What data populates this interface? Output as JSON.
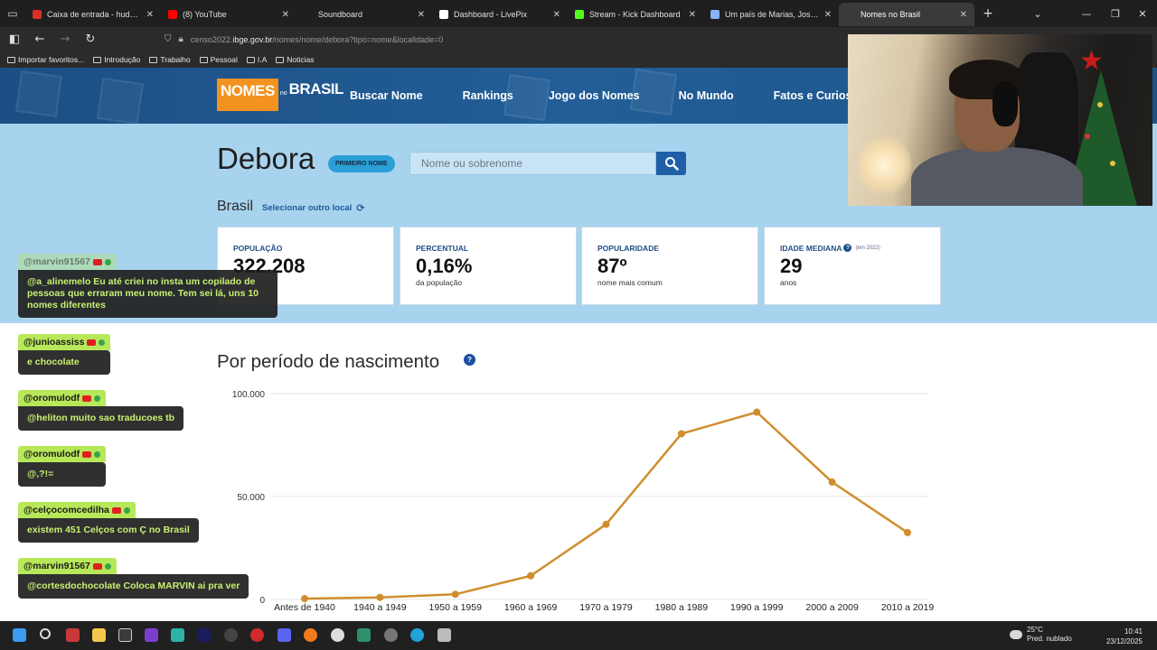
{
  "browser": {
    "tabs": [
      {
        "title": "Caixa de entrada - hudsonfabio",
        "color": "#d93025",
        "active": false
      },
      {
        "title": "(8) YouTube",
        "color": "#ff0000",
        "active": false
      },
      {
        "title": "Soundboard",
        "color": "#1f1f1f",
        "active": false
      },
      {
        "title": "Dashboard - LivePix",
        "color": "#ffffff",
        "active": false
      },
      {
        "title": "Stream - Kick Dashboard",
        "color": "#53fc18",
        "active": false
      },
      {
        "title": "Um país de Marias, Josés, Silvas",
        "color": "#8ab4f8",
        "active": false
      },
      {
        "title": "Nomes no Brasil",
        "color": "#3a3a3a",
        "active": true
      }
    ],
    "new_tab": "+",
    "url_prefix": "censo2022.",
    "url_host": "ibge.gov.br",
    "url_path": "/nomes/nome/debora?tipo=nome&localidade=0",
    "bookmarks": [
      "Importar favoritos...",
      "Introdução",
      "Trabalho",
      "Pessoal",
      "I.A",
      "Noticias"
    ]
  },
  "site": {
    "logo_nomes": "NOMES",
    "logo_no": "no",
    "logo_brasil": "BRASIL",
    "nav": [
      "Buscar Nome",
      "Rankings",
      "Jogo dos Nomes",
      "No Mundo",
      "Fatos e Curiosidades"
    ]
  },
  "hero": {
    "name": "Debora",
    "badge": "PRIMEIRO NOME",
    "search_placeholder": "Nome ou sobrenome",
    "place": "Brasil",
    "select_local": "Selecionar outro local"
  },
  "cards": [
    {
      "label": "POPULAÇÃO",
      "value": "322.208",
      "sub": "",
      "note": "",
      "help": false
    },
    {
      "label": "PERCENTUAL",
      "value": "0,16%",
      "sub": "da população",
      "note": "",
      "help": false
    },
    {
      "label": "POPULARIDADE",
      "value": "87º",
      "sub": "nome mais comum",
      "note": "",
      "help": false
    },
    {
      "label": "IDADE MEDIANA",
      "value": "29",
      "sub": "anos",
      "note": "(em 2022)",
      "help": true
    }
  ],
  "section": {
    "title": "Por período de nascimento",
    "help": "?"
  },
  "chart_data": {
    "type": "line",
    "categories": [
      "Antes de 1940",
      "1940 a 1949",
      "1950 a 1959",
      "1960 a 1969",
      "1970 a 1979",
      "1980 a 1989",
      "1990 a 1999",
      "2000 a 2009",
      "2010 a 2019"
    ],
    "values": [
      400,
      1000,
      2500,
      11500,
      36500,
      80500,
      91000,
      57000,
      32500
    ],
    "yticks": [
      "100.000",
      "50.000",
      "0"
    ],
    "ylim": [
      0,
      100000
    ],
    "color": "#d08d2e",
    "grid": true
  },
  "chat": [
    {
      "user": "@marvin91567",
      "text": "@a_alinemelo Eu até criei no insta um copilado de pessoas que erraram meu nome. Tem sei lá, uns 10 nomes diferentes",
      "faded": true
    },
    {
      "user": "@junioassiss",
      "text": "e chocolate",
      "faded": false
    },
    {
      "user": "@oromulodf",
      "text": "@heliton muito sao traducoes tb",
      "faded": false
    },
    {
      "user": "@oromulodf",
      "text": "@,?!=",
      "faded": false
    },
    {
      "user": "@celçocomcedilha",
      "text": "existem 451 Celços com Ç no Brasil",
      "faded": false
    },
    {
      "user": "@marvin91567",
      "text": "@cortesdochocolate Coloca MARVIN ai pra ver",
      "faded": false
    }
  ],
  "taskbar": {
    "temperature": "25°C",
    "weather": "Pred. nublado",
    "time": "10:41",
    "date": "23/12/2025"
  }
}
